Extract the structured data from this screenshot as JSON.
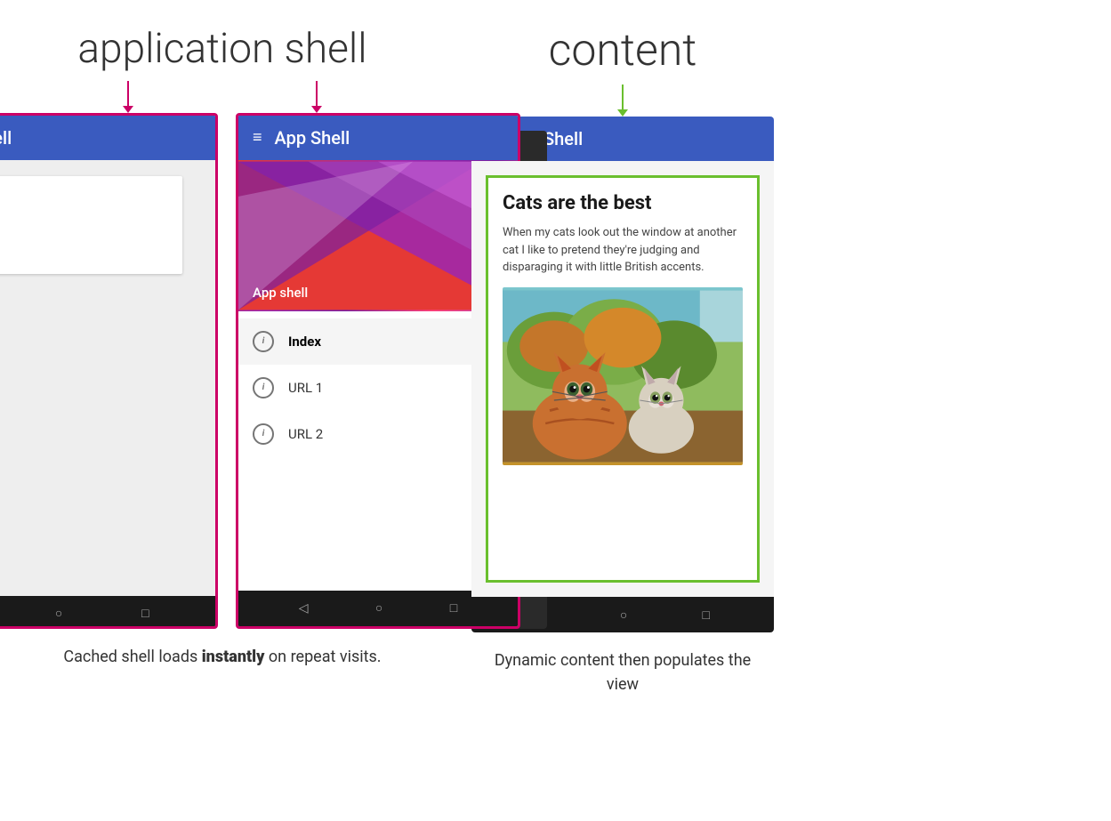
{
  "left_label": "application shell",
  "right_label": "content",
  "phone1": {
    "app_title": "App Shell"
  },
  "phone2": {
    "app_title": "App Shell",
    "drawer_label": "App shell",
    "menu_items": [
      {
        "label": "Index",
        "active": true
      },
      {
        "label": "URL 1",
        "active": false
      },
      {
        "label": "URL 2",
        "active": false
      }
    ]
  },
  "phone3": {
    "app_title": "App Shell",
    "content_title": "Cats are the best",
    "content_text": "When my cats look out the window at another cat I like to pretend they're judging and disparaging it with little British accents."
  },
  "left_caption": "Cached shell loads instantly on repeat visits.",
  "right_caption": "Dynamic content then populates the view",
  "nav": {
    "back": "◁",
    "home": "○",
    "recent": "□"
  },
  "colors": {
    "pink_border": "#cc0066",
    "green_border": "#6abf2e",
    "blue_header": "#3a5bbf",
    "arrow_pink": "#cc0066",
    "arrow_green": "#6abf2e"
  }
}
